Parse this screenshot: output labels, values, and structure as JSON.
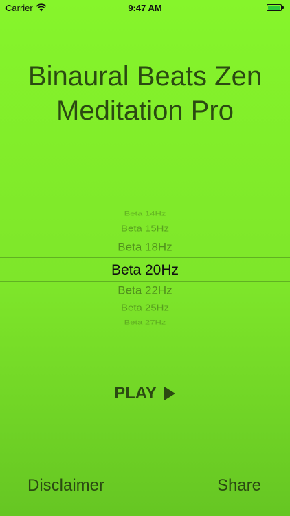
{
  "status_bar": {
    "carrier": "Carrier",
    "time": "9:47 AM",
    "wifi_icon": "wifi-icon",
    "battery_icon": "battery-icon"
  },
  "title": {
    "line1": "Binaural Beats Zen",
    "line2": "Meditation Pro"
  },
  "picker": {
    "items": [
      "Beta 14Hz",
      "Beta 15Hz",
      "Beta 18Hz",
      "Beta 20Hz",
      "Beta 22Hz",
      "Beta 25Hz",
      "Beta 27Hz"
    ],
    "selected": "Beta 20Hz"
  },
  "play": {
    "label": "PLAY",
    "icon": "play-icon"
  },
  "footer": {
    "disclaimer_label": "Disclaimer",
    "share_label": "Share"
  },
  "colors": {
    "background_top": "#86f52b",
    "background_bottom": "#66c623",
    "text": "#2b4a12"
  }
}
